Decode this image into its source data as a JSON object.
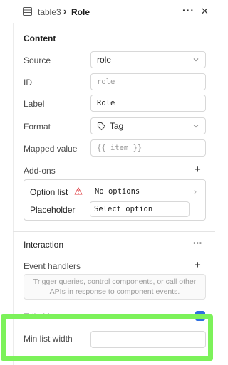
{
  "header": {
    "table_name": "table3",
    "separator": "›",
    "component_name": "Role"
  },
  "content": {
    "section_title": "Content",
    "source": {
      "label": "Source",
      "value": "role"
    },
    "id": {
      "label": "ID",
      "placeholder": "role"
    },
    "label": {
      "label": "Label",
      "value": "Role"
    },
    "format": {
      "label": "Format",
      "value": "Tag"
    },
    "mapped_value": {
      "label": "Mapped value",
      "placeholder": "{{ item }}"
    },
    "addons": {
      "title": "Add-ons",
      "option_list": {
        "label": "Option list",
        "value": "No options"
      },
      "placeholder": {
        "label": "Placeholder",
        "value": "Select option"
      }
    }
  },
  "interaction": {
    "section_title": "Interaction",
    "event_handlers": {
      "label": "Event handlers",
      "hint": "Trigger queries, control components, or call other APIs in response to component events."
    },
    "editable": {
      "label": "Editable",
      "checked": true
    },
    "min_list_width": {
      "label": "Min list width",
      "value": ""
    }
  },
  "colors": {
    "accent": "#2f6fe0",
    "highlight": "#7cf25a",
    "warning": "#e0454a"
  }
}
